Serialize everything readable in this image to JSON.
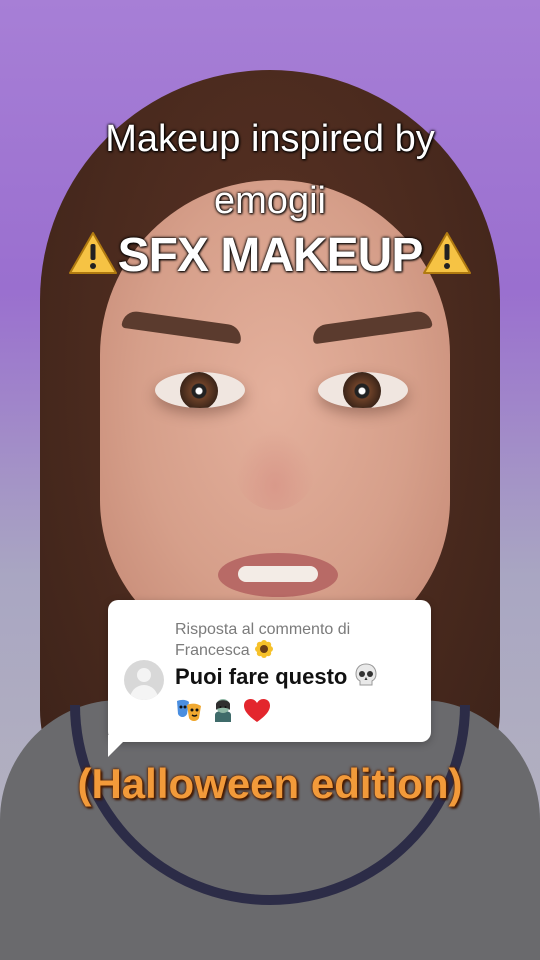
{
  "overlay": {
    "title_line1": "Makeup inspired by",
    "title_line2": "emogii",
    "warning_text": "SFX MAKEUP",
    "warning_icon": "warning-icon"
  },
  "reply": {
    "header_text": "Risposta al commento di Francesca",
    "header_emoji": "sunflower-icon",
    "comment_text": "Puoi fare questo",
    "emojis": [
      "skull-icon",
      "masks-icon",
      "zombie-icon",
      "red-heart-icon"
    ]
  },
  "caption": {
    "bottom_text": "(Halloween edition)"
  },
  "colors": {
    "background_purple": "#a77fd6",
    "caption_orange": "#f29a3a",
    "warning_yellow": "#f6c344"
  }
}
